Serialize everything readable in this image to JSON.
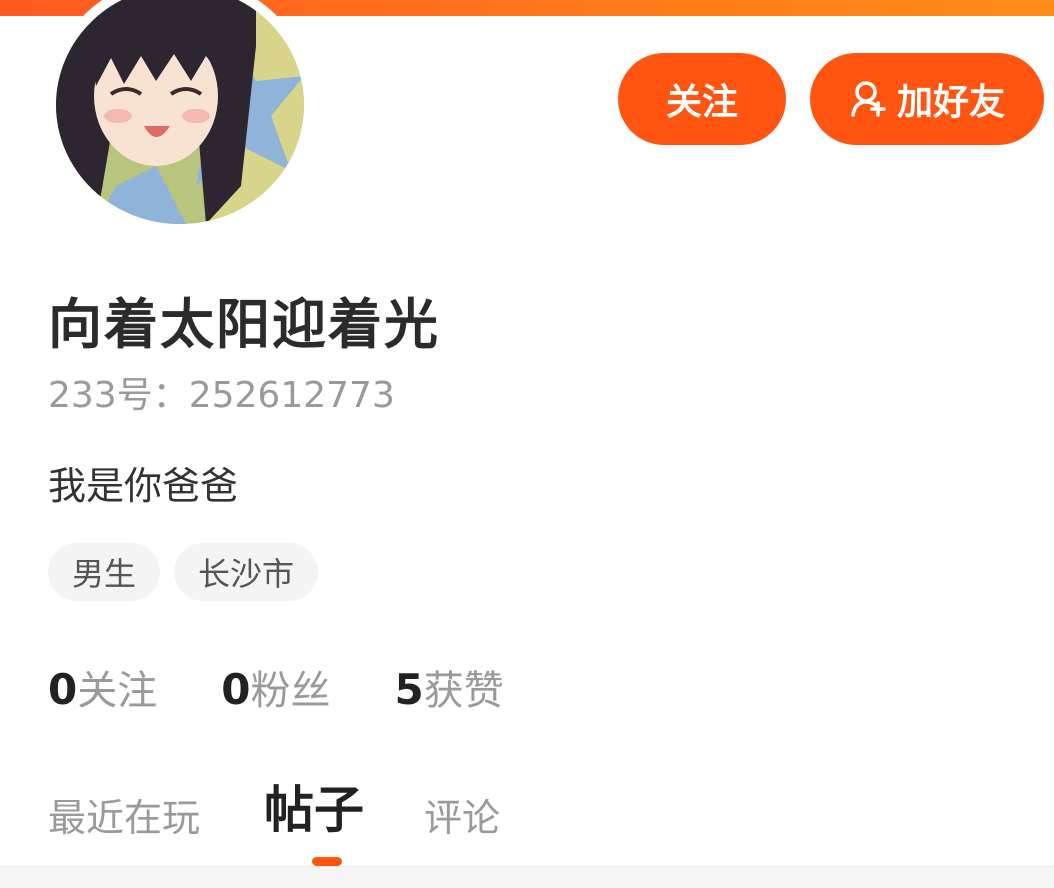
{
  "colors": {
    "accent": "#ff5511",
    "gradient_start": "#ff5a1f",
    "gradient_end": "#ff8c18",
    "muted_text": "#9a9a9a",
    "tag_bg": "#f4f4f4"
  },
  "header": {
    "avatar_icon": "user-avatar-anime-girl",
    "follow_label": "关注",
    "add_friend_icon": "add-friend-icon",
    "add_friend_label": "加好友"
  },
  "profile": {
    "nickname": "向着太阳迎着光",
    "account_id": "233号：252612773",
    "bio": "我是你爸爸",
    "tags": [
      "男生",
      "长沙市"
    ]
  },
  "stats": [
    {
      "count": "0",
      "label": "关注"
    },
    {
      "count": "0",
      "label": "粉丝"
    },
    {
      "count": "5",
      "label": "获赞"
    }
  ],
  "tabs": {
    "items": [
      "最近在玩",
      "帖子",
      "评论"
    ],
    "active": "帖子"
  }
}
